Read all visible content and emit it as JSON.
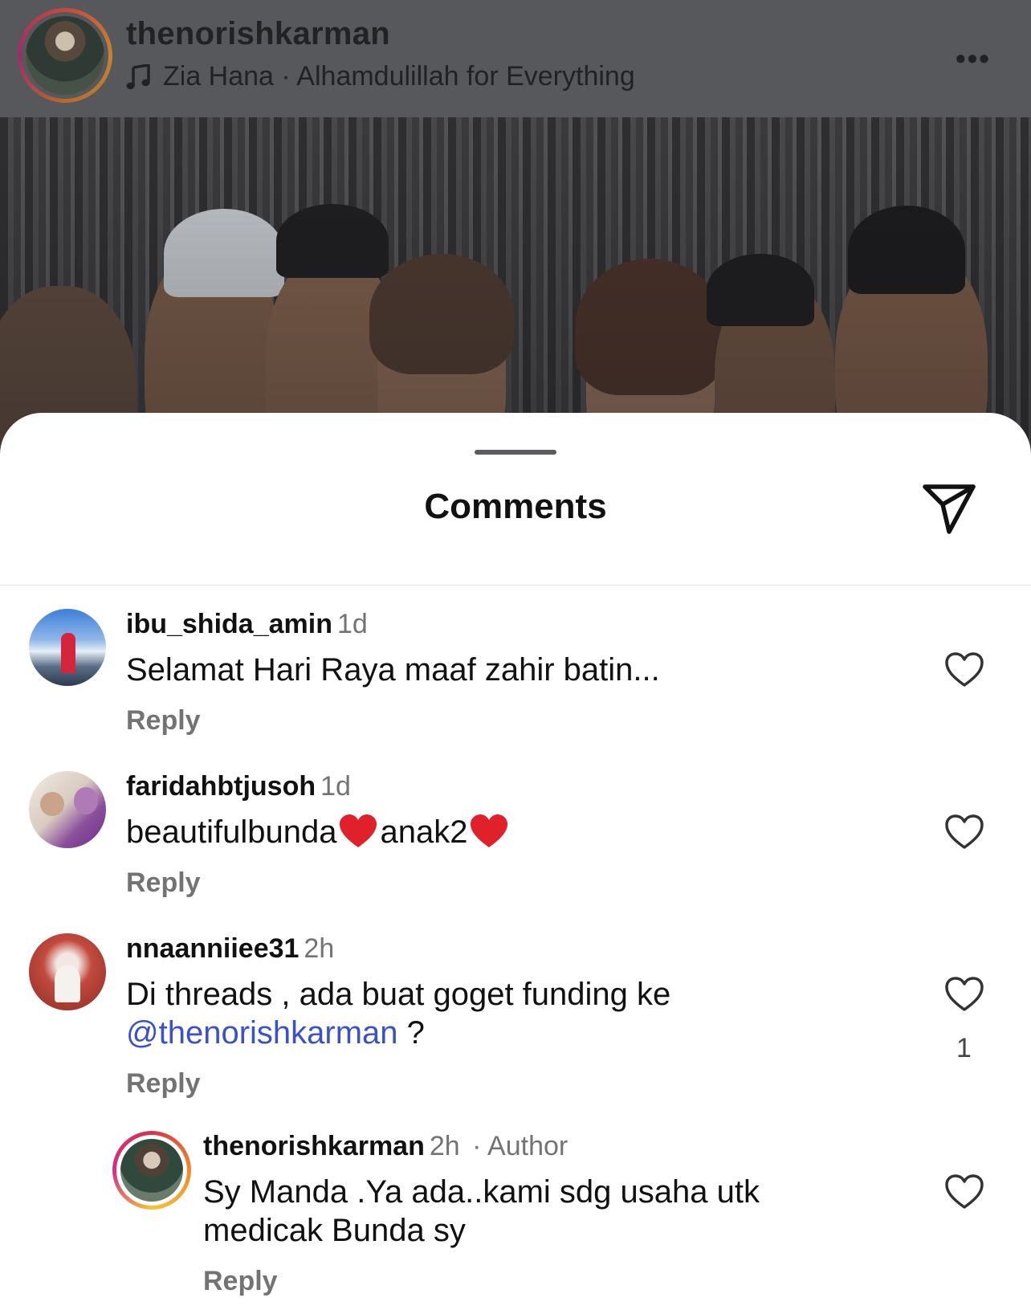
{
  "header": {
    "username": "thenorishkarman",
    "music_text": "Zia Hana · Alhamdulillah for Everything",
    "more_label": "•••"
  },
  "sheet": {
    "title": "Comments"
  },
  "comments": [
    {
      "username": "ibu_shida_amin",
      "time": "1d",
      "text": "Selamat Hari Raya maaf zahir batin...",
      "reply_label": "Reply"
    },
    {
      "username": "faridahbtjusoh",
      "time": "1d",
      "text_part1": "beautifulbunda",
      "text_part2": "anak2",
      "reply_label": "Reply"
    },
    {
      "username": "nnaanniiee31",
      "time": "2h",
      "text_line1": "Di threads , ada buat goget funding ke",
      "mention": "@thenorishkarman",
      "text_line2_suffix": " ?",
      "like_count": "1",
      "reply_label": "Reply"
    },
    {
      "username": "thenorishkarman",
      "time": "2h",
      "author_label": "Author",
      "text_line1": "Sy Manda .Ya ada..kami sdg usaha utk",
      "text_line2": "medicak Bunda sy",
      "reply_label": "Reply"
    }
  ],
  "icons": {
    "music": "music-note-icon",
    "more": "more-options-icon",
    "share": "send-icon",
    "like": "heart-outline-icon",
    "emoji": "red-heart-emoji"
  },
  "colors": {
    "mention": "#3a51c9",
    "meta_text": "#737373",
    "emoji_heart": "#e0202a"
  }
}
